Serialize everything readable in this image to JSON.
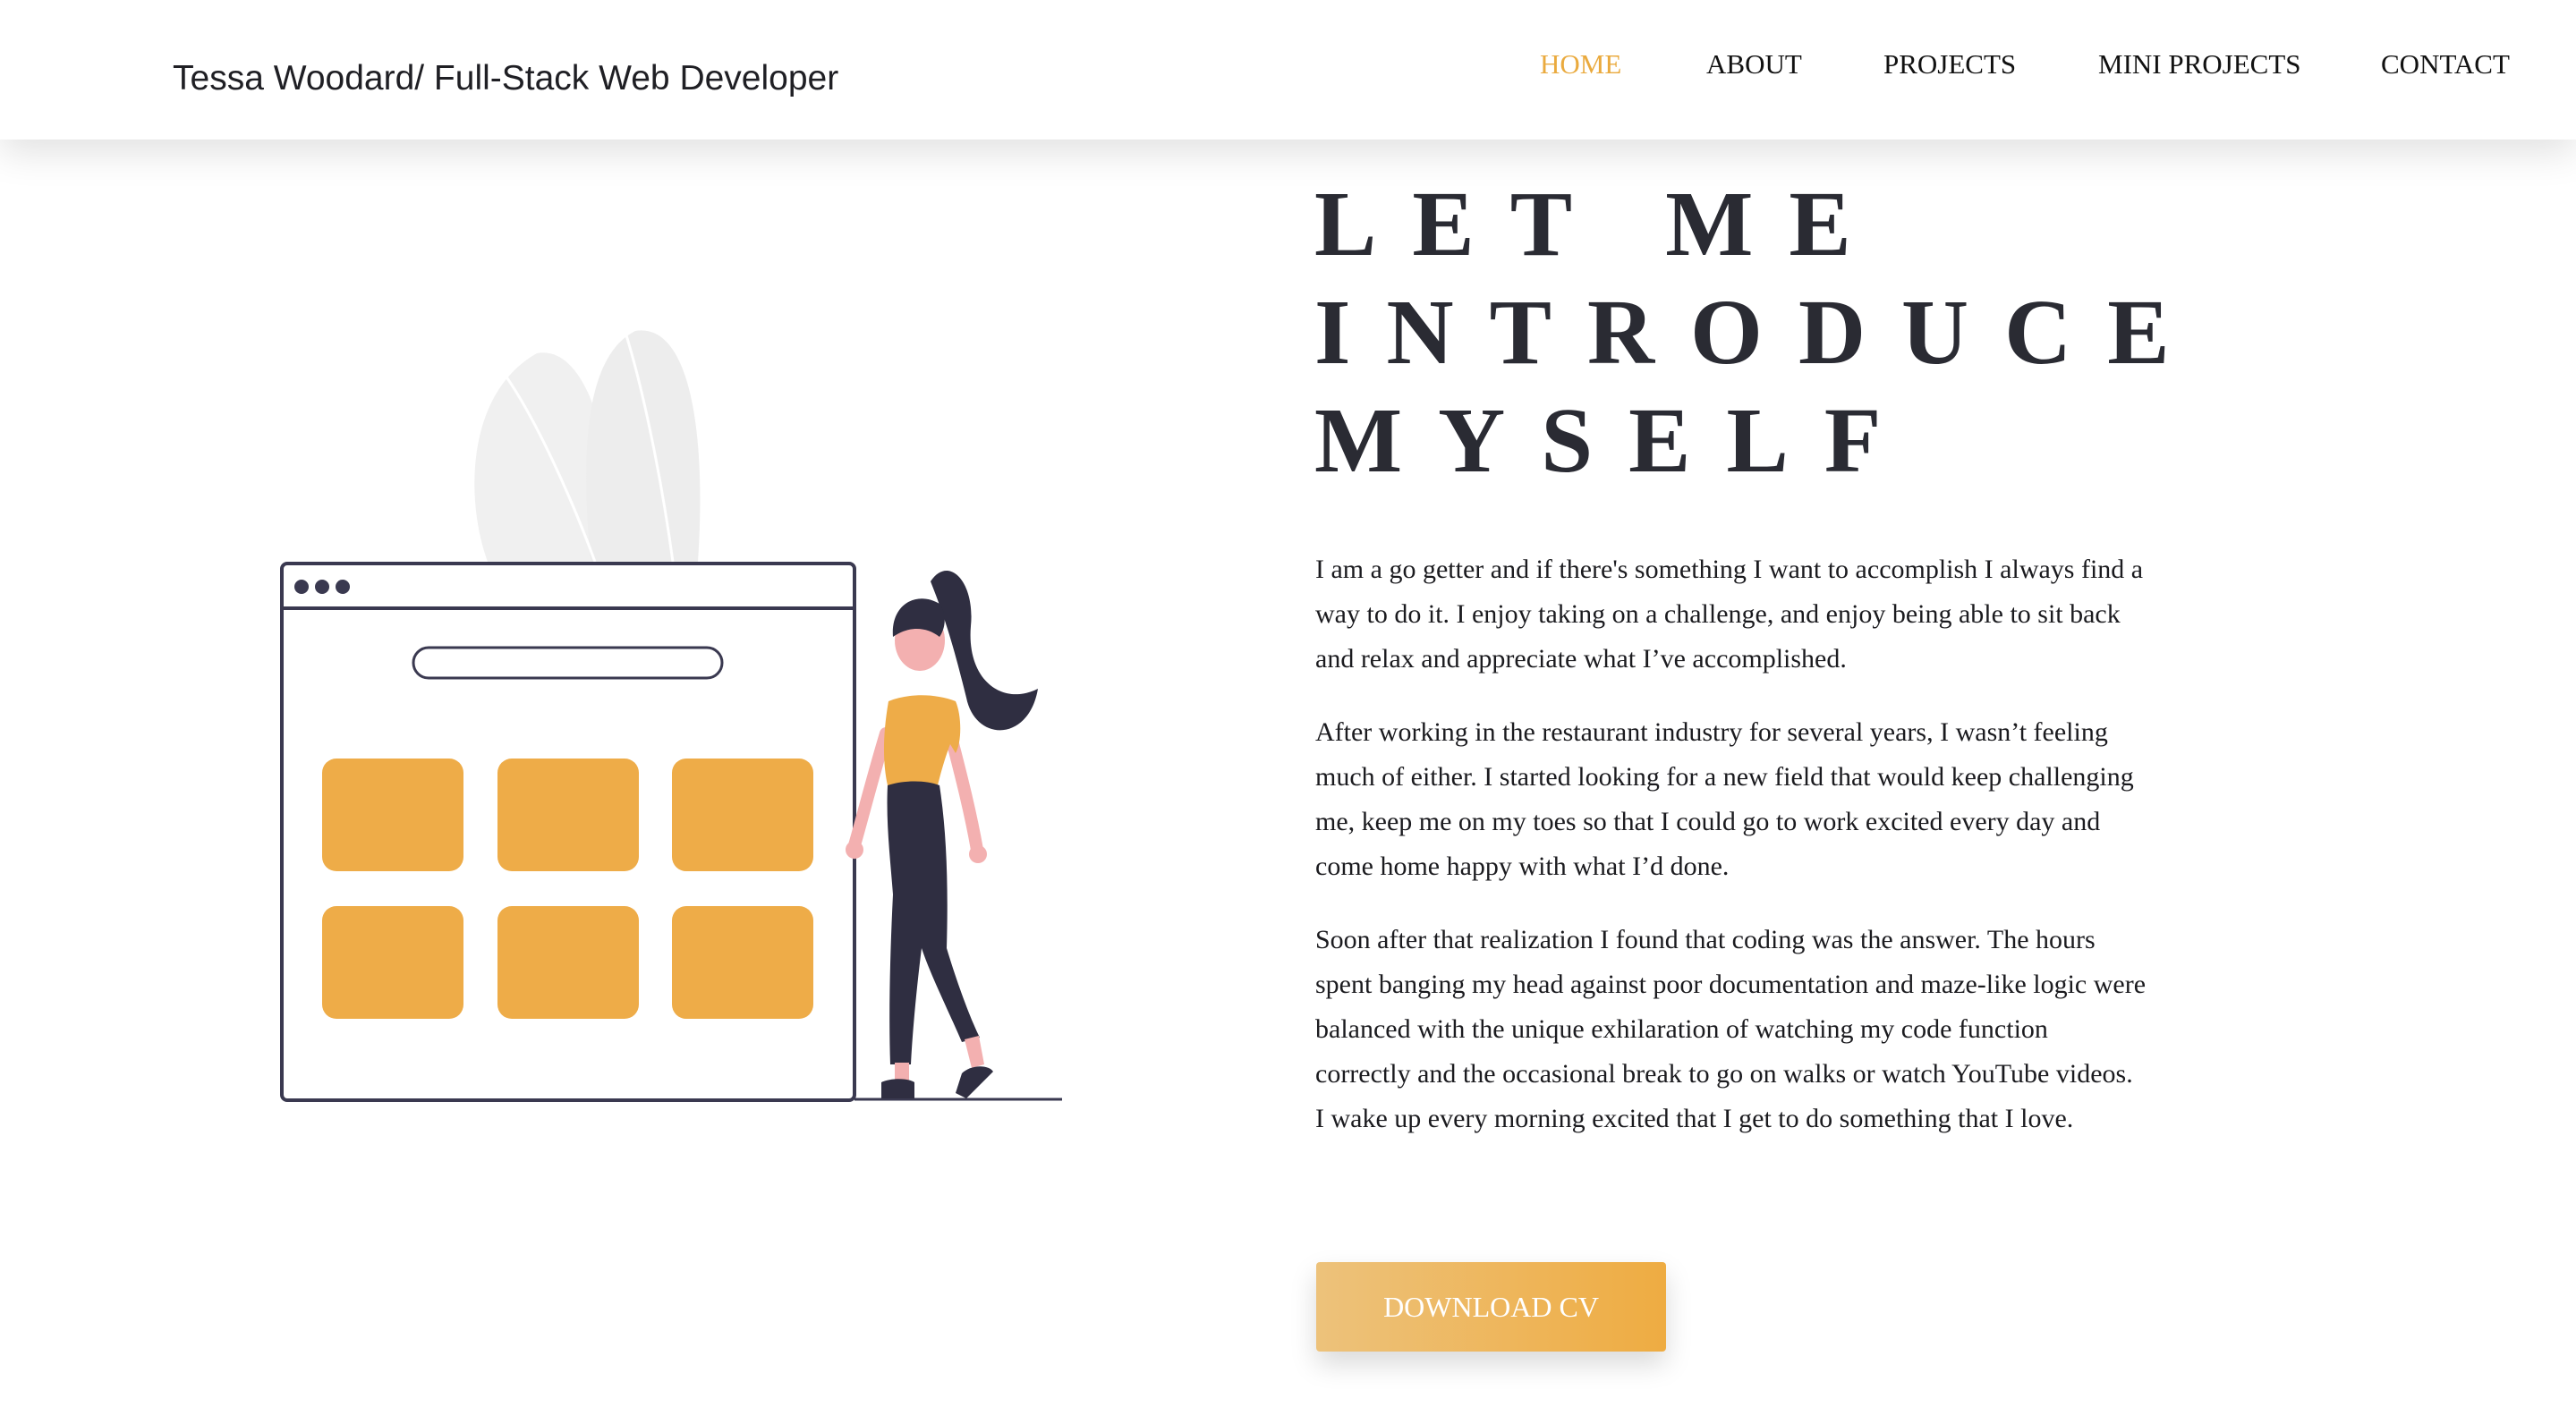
{
  "header": {
    "brand": "Tessa Woodard/ Full-Stack Web Developer",
    "nav": [
      {
        "label": "HOME",
        "active": true
      },
      {
        "label": "ABOUT",
        "active": false
      },
      {
        "label": "PROJECTS",
        "active": false
      },
      {
        "label": "MINI PROJECTS",
        "active": false
      },
      {
        "label": "CONTACT",
        "active": false
      }
    ]
  },
  "intro": {
    "title_lines": [
      "LET ME",
      "INTRODUCE",
      "MYSELF"
    ],
    "paragraphs": [
      "I am a go getter and if there's something I want to accomplish I always find a way to do it. I enjoy taking on a challenge, and enjoy being able to sit back and relax and appreciate what I’ve accomplished.",
      "After working in the restaurant industry for several years, I wasn’t feeling much of either. I started looking for a new field that would keep challenging me, keep me on my toes so that I could go to work excited every day and come home happy with what I’d done.",
      "Soon after that realization I found that coding was the answer. The hours spent banging my head against poor documentation and maze-like logic were balanced with the unique exhilaration of watching my code function correctly and the occasional break to go on walks or watch YouTube videos. I wake up every morning excited that I get to do something that I love."
    ],
    "button_label": "DOWNLOAD CV"
  },
  "illustration": {
    "name": "woman-beside-browser-window-illustration",
    "accent_color": "#eeac48",
    "outline_color": "#3a3950"
  },
  "colors": {
    "accent": "#eaaa3e",
    "heading": "#2a2b33",
    "text": "#1b1b1f"
  }
}
